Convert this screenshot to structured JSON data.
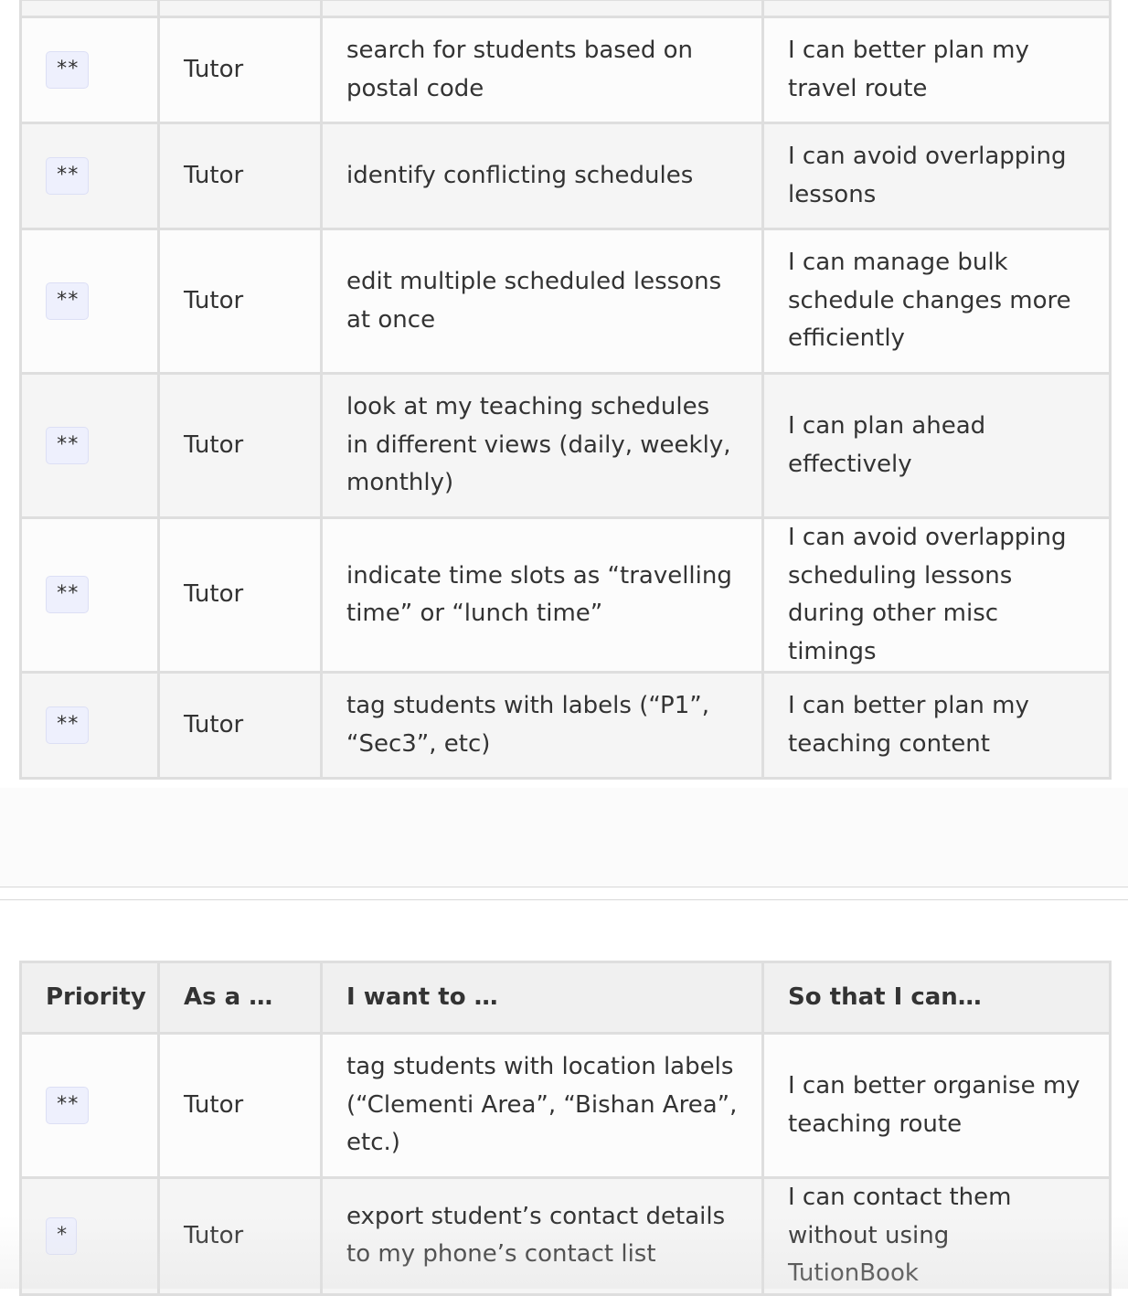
{
  "table1": {
    "rows": [
      {
        "priority": "**",
        "role": "Tutor",
        "want": "search for students based on postal code",
        "so_that": "I can better plan my travel route"
      },
      {
        "priority": "**",
        "role": "Tutor",
        "want": "identify conflicting schedules",
        "so_that": "I can avoid overlapping lessons"
      },
      {
        "priority": "**",
        "role": "Tutor",
        "want": "edit multiple scheduled lessons at once",
        "so_that": "I can manage bulk schedule changes more efficiently"
      },
      {
        "priority": "**",
        "role": "Tutor",
        "want": "look at my teaching schedules in different views (daily, weekly, monthly)",
        "so_that": "I can plan ahead effectively"
      },
      {
        "priority": "**",
        "role": "Tutor",
        "want": "indicate time slots as “travelling time” or “lunch time”",
        "so_that": "I can avoid overlapping scheduling lessons during other misc timings"
      },
      {
        "priority": "**",
        "role": "Tutor",
        "want": "tag students with labels (“P1”, “Sec3”, etc)",
        "so_that": "I can better plan my teaching content"
      }
    ]
  },
  "table2": {
    "headers": [
      "Priority",
      "As a …",
      "I want to …",
      "So that I can…"
    ],
    "rows": [
      {
        "priority": "**",
        "role": "Tutor",
        "want": "tag students with location labels (“Clementi Area”, “Bishan Area”, etc.)",
        "so_that": "I can better organise my teaching route"
      },
      {
        "priority": "*",
        "role": "Tutor",
        "want": "export student’s contact details to my phone’s contact list",
        "so_that": "I can contact them without using TutionBook"
      }
    ]
  }
}
